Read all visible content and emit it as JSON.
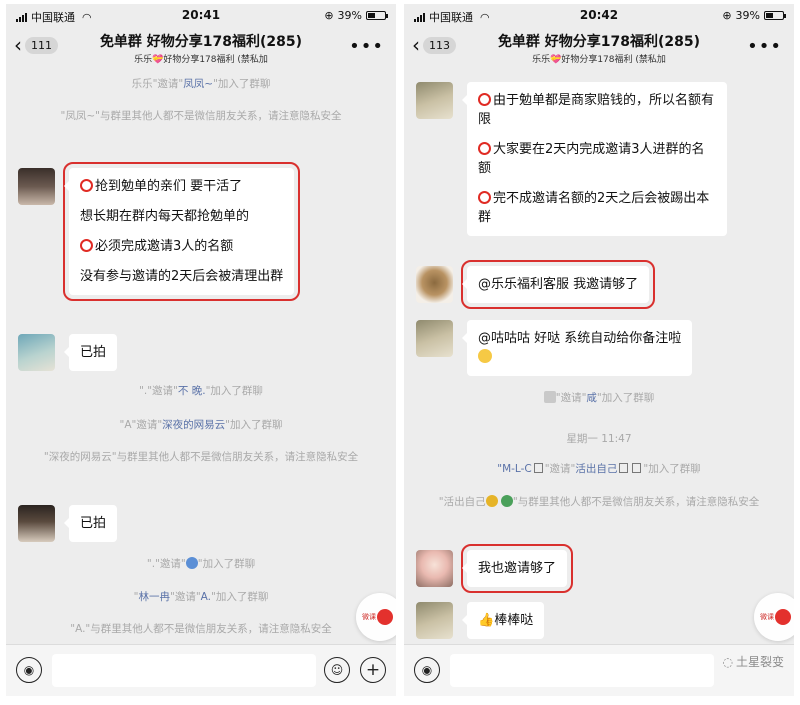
{
  "common": {
    "carrier": "中国联通",
    "battery": "39%",
    "battery_level": 0.39,
    "group_title": "免单群  好物分享178福利(285)",
    "group_subtitle": "乐乐💝好物分享178福利 (禁私加",
    "watermark": "土星裂变"
  },
  "left": {
    "time": "20:41",
    "unread": "111",
    "sys1_prefix": "乐乐\"邀请\"",
    "sys1_name": "凤凤~",
    "sys1_suffix": "\"加入了群聊",
    "sys2": "\"凤凤~\"与群里其他人都不是微信朋友关系，请注意隐私安全",
    "msg1": [
      "抢到勉单的亲们  要干活了",
      "想长期在群内每天都抢勉单的",
      "必须完成邀请3人的名额",
      "没有参与邀请的2天后会被清理出群"
    ],
    "msg2": "已拍",
    "sys3_prefix": "\".\"邀请\"",
    "sys3_name": "不 晚.",
    "sys3_suffix": "\"加入了群聊",
    "sys4_prefix": "\"A\"邀请\"",
    "sys4_name": "深夜的网易云",
    "sys4_suffix": "\"加入了群聊",
    "sys5": "\"深夜的网易云\"与群里其他人都不是微信朋友关系，请注意隐私安全",
    "msg3": "已拍",
    "sys6_prefix": "\".\"邀请\"",
    "sys6_suffix": "\"加入了群聊",
    "sys7_prefix": "\"",
    "sys7_name": "林一冉",
    "sys7_mid": "\"邀请\"",
    "sys7_name2": "A.",
    "sys7_suffix": "\"加入了群聊",
    "sys8": "\"A.\"与群里其他人都不是微信朋友关系，请注意隐私安全",
    "badge": "微课"
  },
  "right": {
    "time": "20:42",
    "unread": "113",
    "msg1": [
      "由于勉单都是商家赔钱的，所以名额有限",
      "大家要在2天内完成邀请3人进群的名额",
      "完不成邀请名额的2天之后会被踢出本群"
    ],
    "msg2": "@乐乐福利客服 我邀请够了",
    "msg3": "@咕咕咕 好哒 系统自动给你备注啦",
    "sys1_prefix": "\"邀请\"",
    "sys1_name": "咸",
    "sys1_suffix": "\"加入了群聊",
    "timestamp": "星期一 11:47",
    "sys2_prefix": "\"M-L-C",
    "sys2_mid": "\"邀请\"",
    "sys2_name": "活出自己",
    "sys2_suffix": "\"加入了群聊",
    "sys3_a": "\"活出自己",
    "sys3_b": "\"与群里其他人都不是微信朋友关系，请注意隐私安全",
    "msg4": "我也邀请够了",
    "msg5": "棒棒哒",
    "badge": "微课"
  },
  "colors": {
    "highlight_border": "#d9302e",
    "name_link": "#5a72a8",
    "chat_bg": "#ededed"
  }
}
